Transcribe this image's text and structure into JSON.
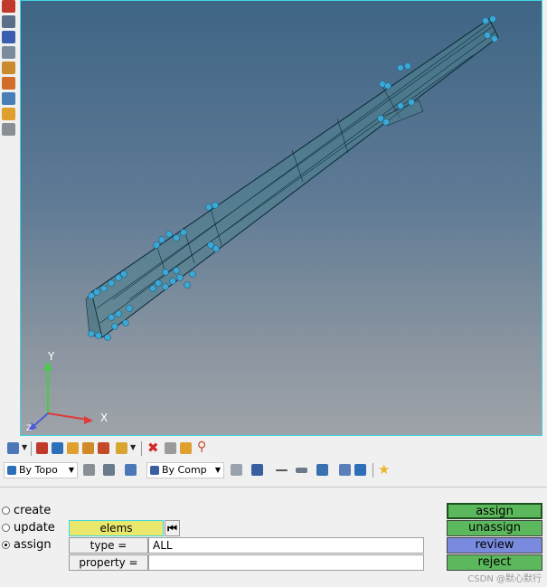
{
  "viewport": {
    "axes": {
      "y_label": "Y",
      "x_label": "X",
      "z_label": "Z"
    },
    "colors": {
      "accent": "#3fd6e0",
      "node": "#3aa9d8"
    }
  },
  "left_toolbar": {
    "icons": [
      "ibeam-icon",
      "connector-icon",
      "id-123-icon",
      "measure-icon",
      "abc-label-icon",
      "abc-marker-icon",
      "transform-icon",
      "panel-icon",
      "cylinder-icon"
    ]
  },
  "toolbar1": {
    "icons": [
      "rotate-icon",
      "components-icon",
      "assemblies-icon",
      "folder-icon",
      "move-icon",
      "bookmark-icon",
      "flag-icon",
      "delete-icon",
      "hide-icon",
      "show-icon",
      "pin-icon"
    ]
  },
  "toolbar2": {
    "topo_dropdown": "By Topo",
    "comp_dropdown": "By Comp",
    "icons": [
      "wireframe-icon",
      "select-icon",
      "surface-icon",
      "solid-icon",
      "box-icon",
      "mesh-icon",
      "line-icon",
      "plane-icon",
      "shell-icon",
      "grid-icon",
      "monitor-icon",
      "star-icon"
    ]
  },
  "panel": {
    "radios": [
      {
        "label": "create",
        "selected": false
      },
      {
        "label": "update",
        "selected": false
      },
      {
        "label": "assign",
        "selected": true
      }
    ],
    "elems_label": "elems",
    "type_label": "type =",
    "type_value": "ALL",
    "property_label": "property =",
    "property_value": "",
    "buttons": {
      "assign": "assign",
      "unassign": "unassign",
      "review": "review",
      "reject": "reject"
    },
    "button_colors": {
      "green": "#5cb85c",
      "blue": "#7a8ade",
      "yellow": "#e9e86c"
    }
  },
  "watermark": "CSDN @默心默行"
}
